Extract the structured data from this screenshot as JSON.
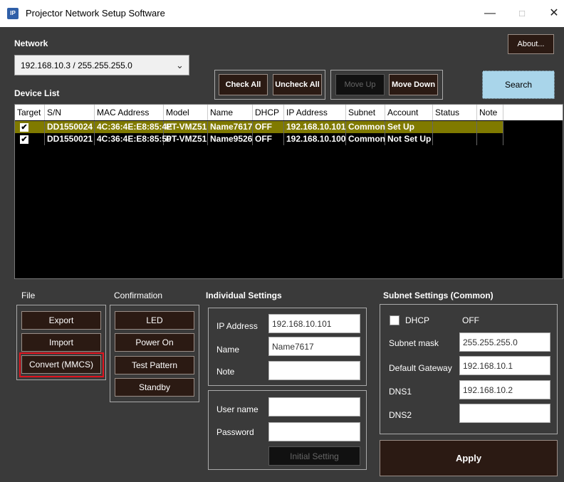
{
  "window": {
    "title": "Projector Network Setup Software",
    "icon_text": "IP",
    "minimize": "—",
    "maximize": "□",
    "close": "✕"
  },
  "network": {
    "label": "Network",
    "selected": "192.168.10.3 / 255.255.255.0",
    "dropdown_glyph": "⌄"
  },
  "about_button": "About...",
  "device_list_label": "Device List",
  "buttons": {
    "check_all": "Check All",
    "uncheck_all": "Uncheck All",
    "move_up": "Move Up",
    "move_down": "Move Down",
    "search": "Search"
  },
  "table": {
    "headers": [
      "Target",
      "S/N",
      "MAC Address",
      "Model",
      "Name",
      "DHCP",
      "IP Address",
      "Subnet",
      "Account",
      "Status",
      "Note"
    ],
    "rows": [
      {
        "checked": "✔",
        "sn": "DD1550024",
        "mac": "4C:36:4E:E8:85:4E",
        "model": "PT-VMZ51",
        "name": "Name7617",
        "dhcp": "OFF",
        "ip": "192.168.10.101",
        "subnet": "Common",
        "account": "Set Up",
        "status": "",
        "note": ""
      },
      {
        "checked": "✔",
        "sn": "DD1550021",
        "mac": "4C:36:4E:E8:85:50",
        "model": "PT-VMZ51",
        "name": "Name9526",
        "dhcp": "OFF",
        "ip": "192.168.10.100",
        "subnet": "Common",
        "account": "Not Set Up",
        "status": "",
        "note": ""
      }
    ],
    "selected_row_color": "#807a00"
  },
  "file": {
    "label": "File",
    "export": "Export",
    "import": "Import",
    "convert": "Convert (MMCS)"
  },
  "confirmation": {
    "label": "Confirmation",
    "led": "LED",
    "power_on": "Power On",
    "test_pattern": "Test Pattern",
    "standby": "Standby"
  },
  "individual": {
    "label": "Individual Settings",
    "ip_label": "IP Address",
    "ip_value": "192.168.10.101",
    "name_label": "Name",
    "name_value": "Name7617",
    "note_label": "Note",
    "note_value": "",
    "user_label": "User name",
    "user_value": "",
    "password_label": "Password",
    "password_value": "",
    "initial_setting": "Initial Setting"
  },
  "subnet": {
    "label": "Subnet Settings (Common)",
    "dhcp_label": "DHCP",
    "dhcp_value": "OFF",
    "mask_label": "Subnet mask",
    "mask_value": "255.255.255.0",
    "gateway_label": "Default Gateway",
    "gateway_value": "192.168.10.1",
    "dns1_label": "DNS1",
    "dns1_value": "192.168.10.2",
    "dns2_label": "DNS2",
    "dns2_value": ""
  },
  "apply": "Apply",
  "colors": {
    "background": "#3a3a3a",
    "button": "#2b1a13",
    "search": "#a9d5ea",
    "highlight": "#e0141e"
  }
}
